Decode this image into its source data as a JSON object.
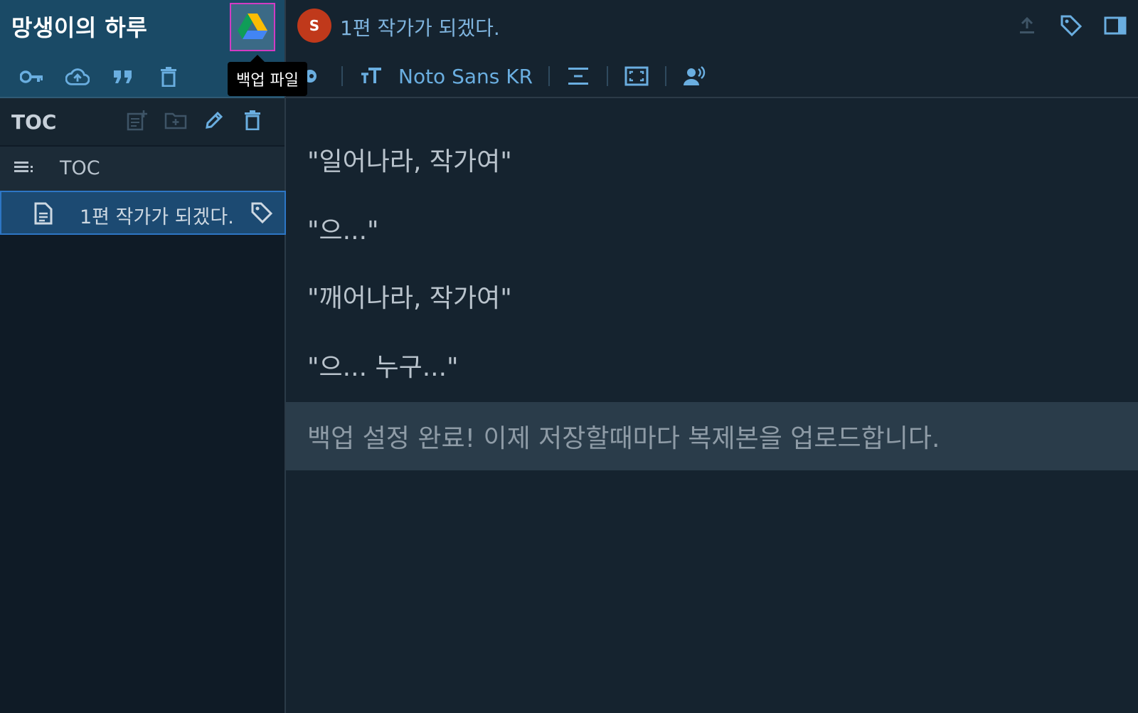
{
  "sidebar": {
    "project_title": "망생이의 하루",
    "drive_button": {
      "icon": "google-drive-icon",
      "tooltip": "백업 파일"
    },
    "tools": [
      "key-icon",
      "cloud-upload-icon",
      "quote-icon",
      "trash-icon"
    ],
    "toc": {
      "title": "TOC",
      "tools": [
        "add-document-icon",
        "add-folder-icon",
        "edit-icon",
        "trash-icon"
      ],
      "root_label": "TOC",
      "items": [
        {
          "label": "1편 작가가 되겠다.",
          "icon": "document-icon",
          "selected": true
        }
      ]
    }
  },
  "main": {
    "avatar_letter": "S",
    "avatar_color": "#c0391b",
    "document_title": "1편 작가가 되겠다.",
    "top_icons": [
      "upload-icon",
      "tag-icon",
      "panel-toggle-icon"
    ],
    "format_bar": {
      "font_name": "Noto Sans KR",
      "icons": [
        "palette-icon",
        "font-size-icon",
        "line-spacing-icon",
        "fullscreen-icon",
        "voice-icon"
      ]
    },
    "paragraphs": [
      "\"일어나라, 작가여\"",
      "\"으...\"",
      "\"깨어나라, 작가여\"",
      "\"으... 누구...\""
    ],
    "notice": "백업 설정 완료! 이제 저장할때마다 복제본을 업로드합니다."
  },
  "colors": {
    "sidebar_header_bg": "#1a4a66",
    "selected_item_bg": "#1c4a72",
    "accent_blue": "#6aaee0",
    "tooltip_highlight": "#d23bc4"
  }
}
